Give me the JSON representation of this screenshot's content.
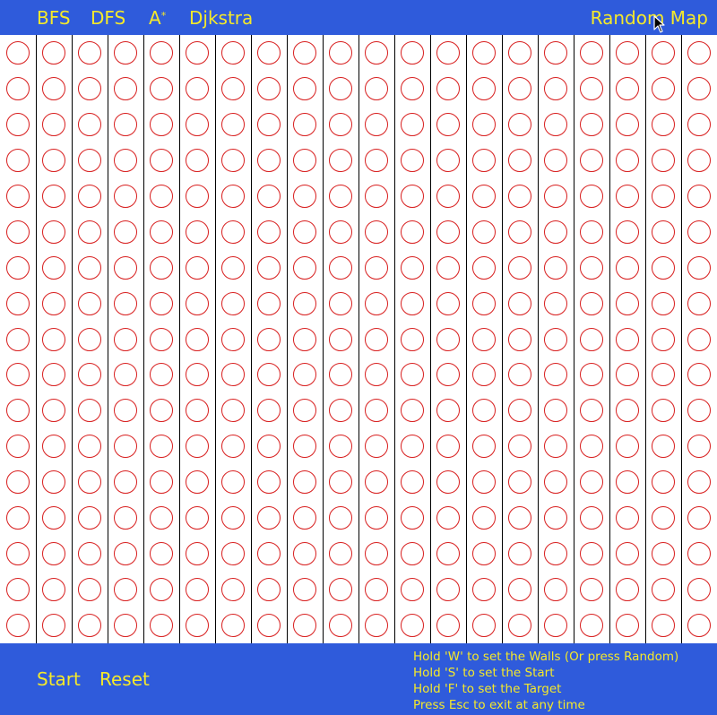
{
  "colors": {
    "bar": "#2f5bdb",
    "text": "#f5e92a",
    "circle": "#d81e1e",
    "grid_line": "#000000",
    "cell_bg": "#ffffff"
  },
  "toolbar": {
    "bfs": "BFS",
    "dfs": "DFS",
    "astar": "A",
    "astar_sup": "*",
    "dijkstra": "Djkstra",
    "random_map": "Random Map"
  },
  "grid": {
    "columns": 20,
    "rows": 17
  },
  "footer": {
    "start": "Start",
    "reset": "Reset",
    "instructions": [
      "Hold 'W' to set the Walls (Or press Random)",
      "Hold 'S' to set the Start",
      "Hold 'F' to set the Target",
      "Press Esc to exit at any time"
    ]
  },
  "icons": {
    "cursor": "mouse-pointer-icon"
  }
}
